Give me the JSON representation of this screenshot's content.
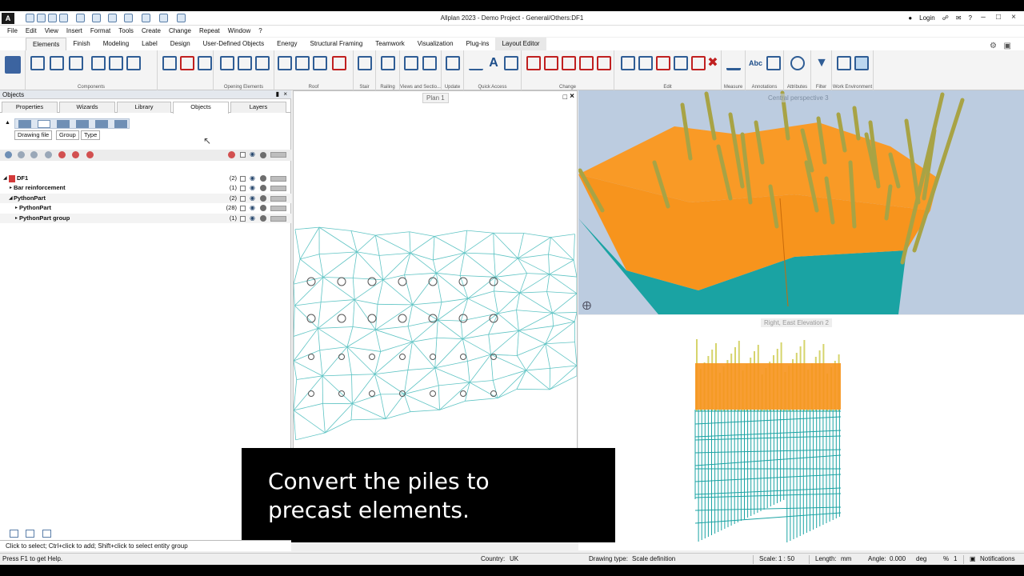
{
  "window": {
    "title": "Allplan 2023 - Demo Project - General/Others:DF1",
    "login_label": "Login"
  },
  "menu": [
    "File",
    "Edit",
    "View",
    "Insert",
    "Format",
    "Tools",
    "Create",
    "Change",
    "Repeat",
    "Window",
    "?"
  ],
  "ribbon_tabs": [
    "Elements",
    "Finish",
    "Modeling",
    "Label",
    "Design",
    "User-Defined Objects",
    "Energy",
    "Structural Framing",
    "Teamwork",
    "Visualization",
    "Plug-ins",
    "Layout Editor"
  ],
  "ribbon_groups": [
    "Components",
    "Opening Elements",
    "Roof",
    "Stair",
    "Railing",
    "Views and Sectio...",
    "Update",
    "Quick Access",
    "Change",
    "Edit",
    "Measure",
    "Annotations",
    "Attributes",
    "Filter",
    "Work Environment"
  ],
  "panel": {
    "title": "Objects",
    "tabs": [
      "Properties",
      "Wizards",
      "Library",
      "Objects",
      "Layers"
    ],
    "filter_buttons": [
      "Drawing file",
      "Group",
      "Type"
    ],
    "rows": [
      {
        "label": "DF1",
        "count": "(2)"
      },
      {
        "label": "Bar reinforcement",
        "count": "(1)"
      },
      {
        "label": "PythonPart",
        "count": "(2)"
      },
      {
        "label": "PythonPart",
        "count": "(28)"
      },
      {
        "label": "PythonPart group",
        "count": "(1)"
      }
    ]
  },
  "viewports": {
    "plan": "Plan 1",
    "perspective": "Central perspective 3",
    "elevation": "Right, East Elevation 2"
  },
  "caption": {
    "line1": "Convert the piles to",
    "line2": "precast elements."
  },
  "hint": "Click to select; Ctrl+click to add; Shift+click to select entity group",
  "status": {
    "help": "Press F1 to get Help.",
    "country_label": "Country:",
    "country": "UK",
    "drawing_type_label": "Drawing type:",
    "drawing_type": "Scale definition",
    "scale_label": "Scale:",
    "scale": "1 : 50",
    "length_label": "Length:",
    "length": "mm",
    "angle_label": "Angle:",
    "angle": "0.000",
    "angle_unit": "deg",
    "percent_label": "%",
    "percent": "1",
    "notifications": "Notifications"
  },
  "colors": {
    "orange": "#f7941d",
    "teal": "#1aa3a3",
    "pile": "#c8c46a",
    "mesh": "#5fc4c4"
  }
}
